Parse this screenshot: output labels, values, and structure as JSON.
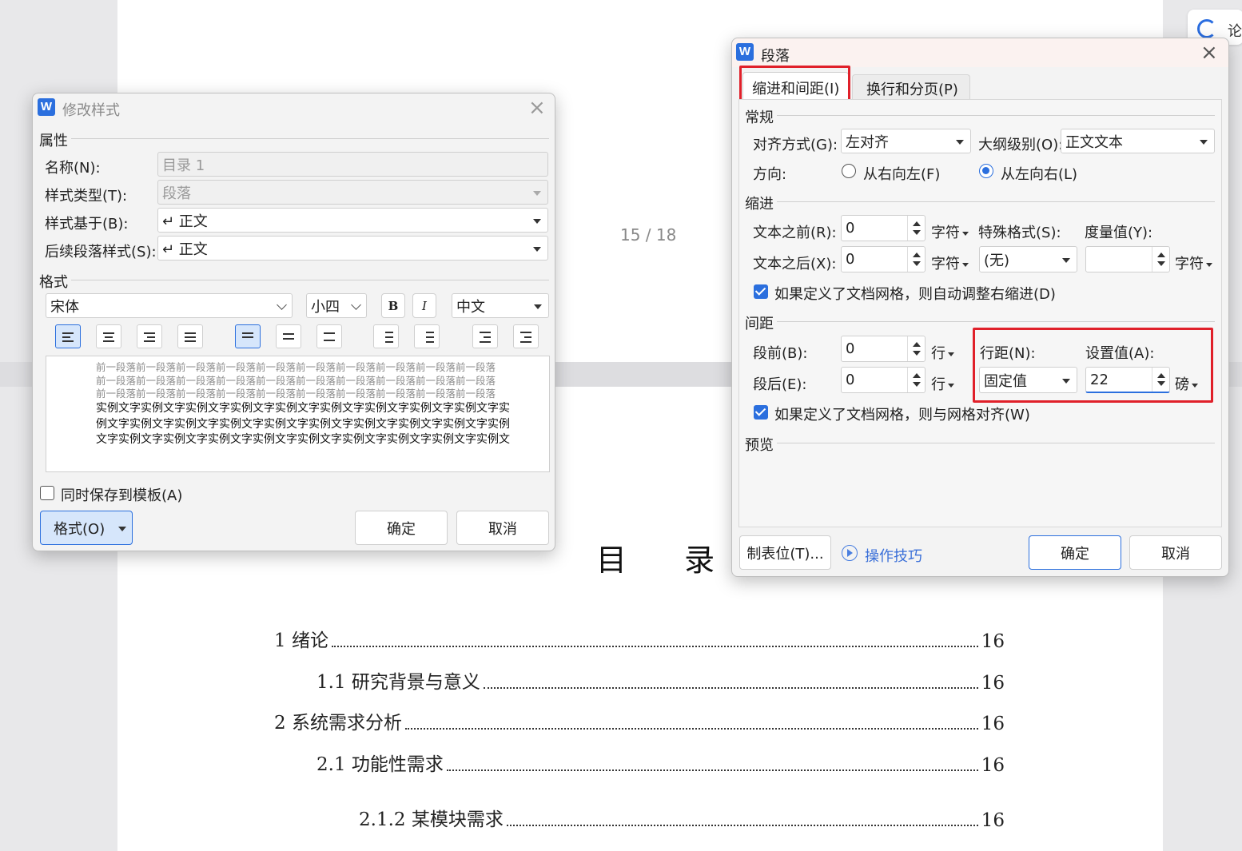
{
  "document": {
    "page_indicator": "15 / 18",
    "toc_title": "目 录",
    "toc_entries": [
      {
        "text": "1  绪论",
        "page": "16"
      },
      {
        "text": "1.1  研究背景与意义",
        "page": "16"
      },
      {
        "text": "2  系统需求分析",
        "page": "16"
      },
      {
        "text": "2.1  功能性需求",
        "page": "16"
      },
      {
        "text": "2.1.2  某模块需求",
        "page": "16"
      }
    ]
  },
  "side_panel": {
    "label": "论"
  },
  "modify_style": {
    "title": "修改样式",
    "props_header": "属性",
    "name_label": "名称(N):",
    "name_value": "目录 1",
    "type_label": "样式类型(T):",
    "type_value": "段落",
    "based_label": "样式基于(B):",
    "based_value": "↵ 正文",
    "next_label": "后续段落样式(S):",
    "next_value": "↵ 正文",
    "format_header": "格式",
    "font": "宋体",
    "size": "小四",
    "bold": "B",
    "italic": "I",
    "lang": "中文",
    "preview_prev": [
      "前一段落前一段落前一段落前一段落前一段落前一段落前一段落前一段落前一段落前一段落",
      "前一段落前一段落前一段落前一段落前一段落前一段落前一段落前一段落前一段落前一段落",
      "前一段落前一段落前一段落前一段落前一段落前一段落前一段落前一段落前一段落前一段落"
    ],
    "preview_sample": [
      "实例文字实例文字实例文字实例文字实例文字实例文字实例文字实例文字实例文字实",
      "例文字实例文字实例文字实例文字实例文字实例文字实例文字实例文字实例文字实例",
      "文字实例文字实例文字实例文字实例文字实例文字实例文字实例文字实例文字实例文"
    ],
    "save_template": "同时保存到模板(A)",
    "format_btn": "格式(O)",
    "ok": "确定",
    "cancel": "取消"
  },
  "paragraph": {
    "title": "段落",
    "tab1": "缩进和间距(I)",
    "tab2": "换行和分页(P)",
    "general": "常规",
    "align_label": "对齐方式(G):",
    "align_value": "左对齐",
    "outline_label": "大纲级别(O):",
    "outline_value": "正文文本",
    "direction_label": "方向:",
    "rtl": "从右向左(F)",
    "ltr": "从左向右(L)",
    "indent": "缩进",
    "before_text_label": "文本之前(R):",
    "before_text_value": "0",
    "after_text_label": "文本之后(X):",
    "after_text_value": "0",
    "unit_char": "字符",
    "special_label": "特殊格式(S):",
    "special_value": "(无)",
    "measure_label": "度量值(Y):",
    "measure_value": "",
    "auto_indent": "如果定义了文档网格，则自动调整右缩进(D)",
    "spacing": "间距",
    "space_before_label": "段前(B):",
    "space_before_value": "0",
    "space_after_label": "段后(E):",
    "space_after_value": "0",
    "unit_line": "行",
    "line_spacing_label": "行距(N):",
    "line_spacing_value": "固定值",
    "set_value_label": "设置值(A):",
    "set_value": "22",
    "unit_pt": "磅",
    "grid_align": "如果定义了文档网格，则与网格对齐(W)",
    "preview": "预览",
    "tabs_btn": "制表位(T)...",
    "tips": "操作技巧",
    "ok": "确定",
    "cancel": "取消"
  },
  "colors": {
    "accent": "#2b6fde",
    "highlight": "#e0202a"
  }
}
